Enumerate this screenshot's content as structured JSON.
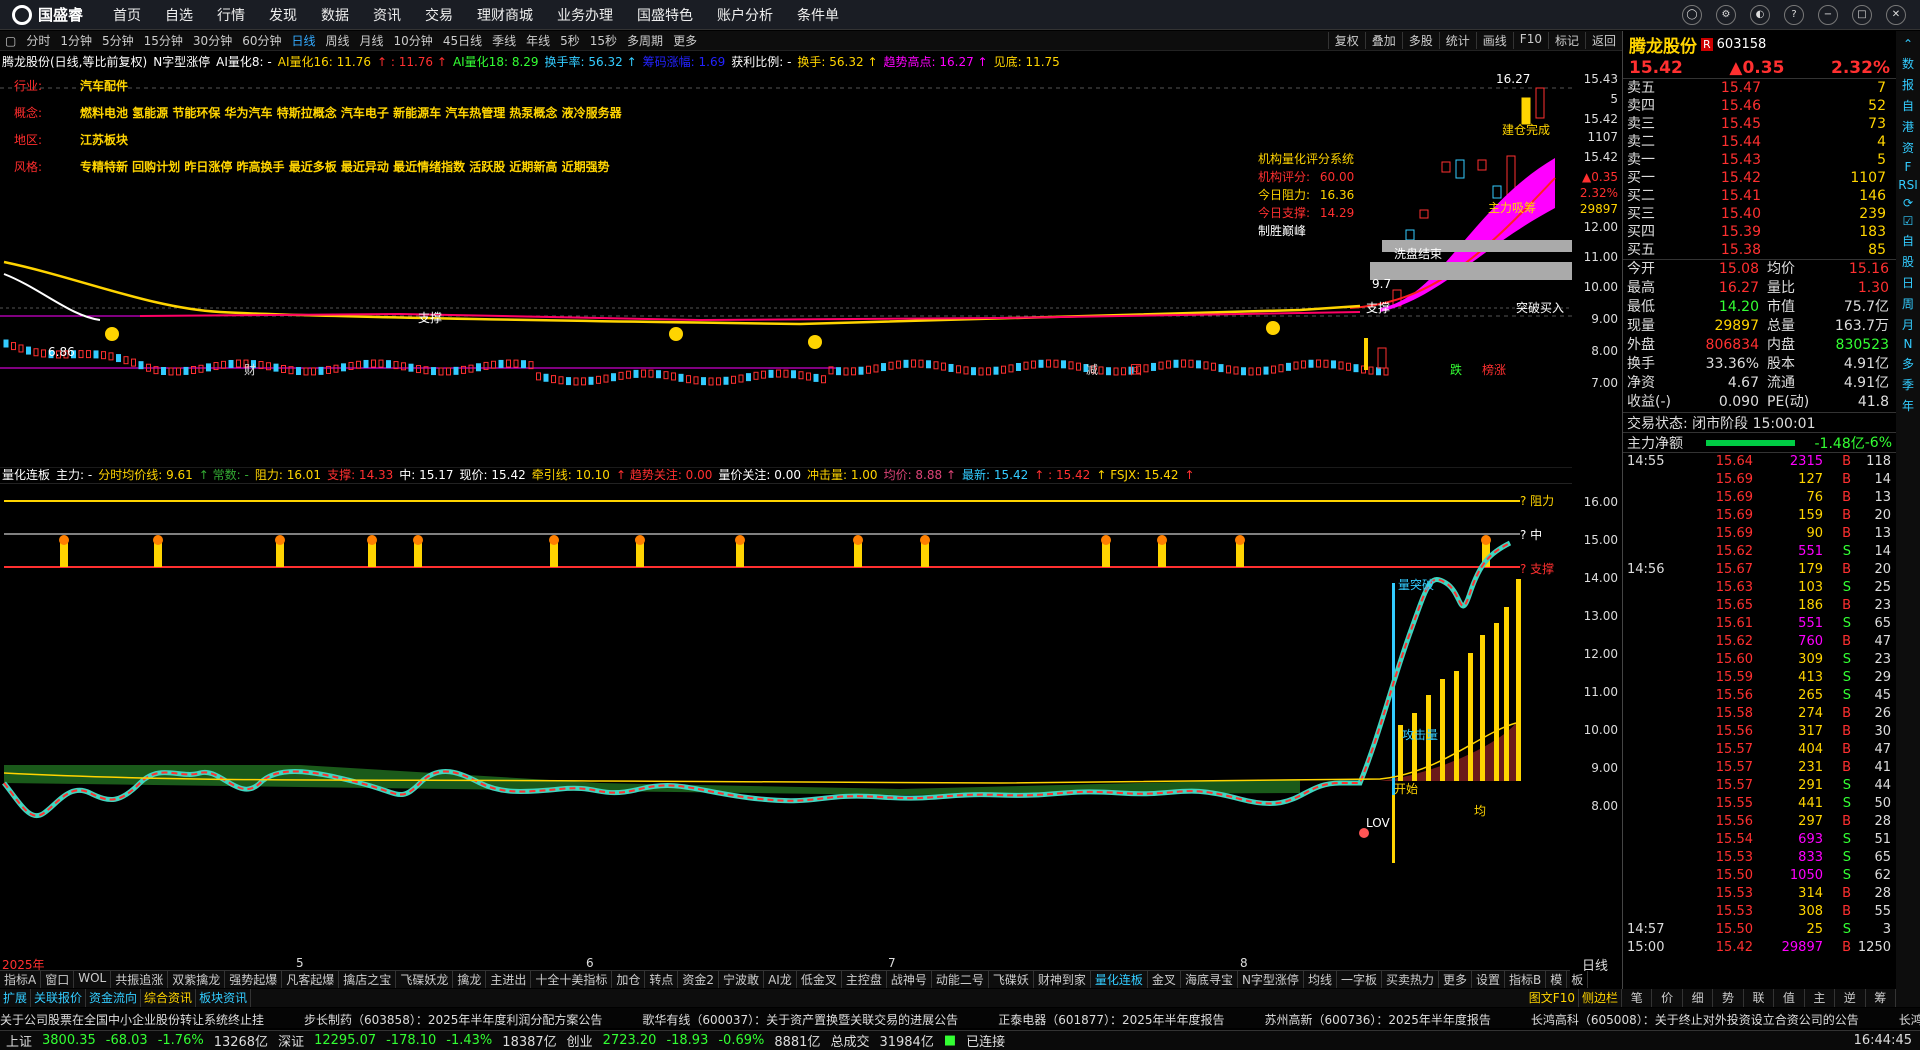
{
  "app": {
    "logo": "国盛睿",
    "menu": [
      "首页",
      "自选",
      "行情",
      "发现",
      "数据",
      "资讯",
      "交易",
      "理财商城",
      "业务办理",
      "国盛特色",
      "账户分析",
      "条件单"
    ]
  },
  "periods": [
    "分时",
    "1分钟",
    "5分钟",
    "15分钟",
    "30分钟",
    "60分钟",
    "日线",
    "周线",
    "月线",
    "10分钟",
    "45日线",
    "季线",
    "年线",
    "5秒",
    "15秒",
    "多周期",
    "更多"
  ],
  "toolbar": [
    "复权",
    "叠加",
    "多股",
    "统计",
    "画线",
    "F10",
    "标记",
    "返回"
  ],
  "legend1": [
    {
      "t": "腾龙股份(日线,等比前复权)",
      "c": "#fff"
    },
    {
      "t": "N字型涨停",
      "c": "#fff"
    },
    {
      "t": "AI量化8: -",
      "c": "#fff"
    },
    {
      "t": "AI量化16: 11.76",
      "c": "#ffd400"
    },
    {
      "t": "↑ : 11.76 ↑",
      "c": "#ff3030"
    },
    {
      "t": "AI量化18: 8.29",
      "c": "#3f3"
    },
    {
      "t": "换手率: 56.32 ↑",
      "c": "#3cf"
    },
    {
      "t": "筹码涨幅: 1.69",
      "c": "#22f"
    },
    {
      "t": "获利比例: -",
      "c": "#fff"
    },
    {
      "t": "换手: 56.32 ↑",
      "c": "#ffd400"
    },
    {
      "t": "趋势高点: 16.27 ↑",
      "c": "#f0f"
    },
    {
      "t": "见底: 11.75",
      "c": "#ffd400"
    }
  ],
  "info": [
    {
      "k": "行业:",
      "v": "汽车配件"
    },
    {
      "k": "概念:",
      "v": "燃料电池 氢能源 节能环保 华为汽车 特斯拉概念 汽车电子 新能源车 汽车热管理 热泵概念 液冷服务器"
    },
    {
      "k": "地区:",
      "v": "江苏板块"
    },
    {
      "k": "风格:",
      "v": "专精特新 回购计划 昨日涨停 昨高换手 最近多板 最近异动 最近情绪指数 活跃股 近期新高 近期强势"
    }
  ],
  "inst": {
    "title": "机构量化评分系统",
    "rows": [
      {
        "k": "机构评分:",
        "v": "60.00",
        "c": "#ff3030"
      },
      {
        "k": "今日阻力:",
        "v": "16.36",
        "c": "#ffd400"
      },
      {
        "k": "今日支撑:",
        "v": "14.29",
        "c": "#ff3030"
      }
    ],
    "foot": "制胜巅峰"
  },
  "chart1_labels": {
    "high": "16.27",
    "low": "6.86",
    "zhicheng1": "支撑",
    "zhicheng2": "支撑",
    "jiancang": "建仓完成",
    "zhuli": "主力吸筹",
    "xipan": "洗盘结束",
    "tupo": "突破买入",
    "cai": "财",
    "jian": "减",
    "hui": "回",
    "die": "跌",
    "zhang": "榜涨",
    "v97": "9.7"
  },
  "axis1": [
    "15.43",
    "5",
    "15.42",
    "1107",
    "15.42",
    "▲0.35",
    "2.32%",
    "29897",
    "12.00",
    "11.00",
    "10.00",
    "9.00",
    "8.00",
    "7.00"
  ],
  "legend2": [
    {
      "t": "量化连板",
      "c": "#fff"
    },
    {
      "t": "主力: -",
      "c": "#fff"
    },
    {
      "t": "分时均价线: 9.61",
      "c": "#ffd400"
    },
    {
      "t": "↑ 常数: -",
      "c": "#3a3"
    },
    {
      "t": "阻力: 16.01",
      "c": "#ffd400"
    },
    {
      "t": "支撑: 14.33",
      "c": "#ff3030"
    },
    {
      "t": "中: 15.17",
      "c": "#fff"
    },
    {
      "t": "现价: 15.42",
      "c": "#fff"
    },
    {
      "t": "牵引线: 10.10",
      "c": "#ffd400"
    },
    {
      "t": "↑ 趋势关注: 0.00",
      "c": "#ff3030"
    },
    {
      "t": "量价关注: 0.00",
      "c": "#fff"
    },
    {
      "t": "冲击量: 1.00",
      "c": "#ffd400"
    },
    {
      "t": "均价: 8.88 ↑",
      "c": "#d47"
    },
    {
      "t": "最新: 15.42",
      "c": "#3cf"
    },
    {
      "t": "↑ : 15.42",
      "c": "#ff3030"
    },
    {
      "t": "↑ FSJX: 15.42",
      "c": "#ffd400"
    },
    {
      "t": "↑",
      "c": "#ff3030"
    }
  ],
  "axis2": [
    "16.00",
    "15.00",
    "14.00",
    "13.00",
    "12.00",
    "11.00",
    "10.00",
    "9.00",
    "8.00"
  ],
  "chart2_labels": {
    "zuli": "? 阻力",
    "zhong": "? 中",
    "zhicheng": "? 支撑",
    "liangtu": "量突破",
    "gongji": "攻击量",
    "kaishi": "开始",
    "jun": "均",
    "lov": "LOV"
  },
  "xdates": [
    "2025年",
    "5",
    "6",
    "7",
    "8"
  ],
  "rixian": "日线",
  "bottom_tabs": [
    "指标A",
    "窗口",
    "WOL",
    "共振追涨",
    "双紫擒龙",
    "强势起爆",
    "凡客起爆",
    "擒店之宝",
    "飞碟妖龙",
    "擒龙",
    "主进出",
    "十全十美指标",
    "加仓",
    "转点",
    "资金2",
    "宁波敢",
    "AI龙",
    "低金叉",
    "主控盘",
    "战神号",
    "动能二号",
    "飞碟妖",
    "财神到家",
    "量化连板",
    "金叉",
    "海底寻宝",
    "N字型涨停",
    "均线",
    "一字板",
    "买卖热力",
    "更多",
    "设置"
  ],
  "bottom_right": [
    "指标B",
    "模",
    "板"
  ],
  "bottom2": [
    "扩展",
    "关联报价",
    "资金流向",
    "综合资讯",
    "板块资讯"
  ],
  "bottom2_right": [
    "图文F10",
    "侧边栏"
  ],
  "ticker": [
    "关于公司股票在全国中小企业股份转让系统终止挂",
    "步长制药（603858）：2025年半年度利润分配方案公告",
    "歌华有线（600037）：关于资产置换暨关联交易的进展公告",
    "正泰电器（601877）：2025年半年度报告",
    "苏州高新（600736）：2025年半年度报告",
    "长鸿高科（605008）：关于终止对外投资设立合资公司的公告",
    "长鸿高"
  ],
  "status": {
    "sh": "上证",
    "sh_v": "3800.35",
    "sh_c": "-68.03",
    "sh_p": "-1.76%",
    "sh_a": "13268亿",
    "sz": "深证",
    "sz_v": "12295.07",
    "sz_c": "-178.10",
    "sz_p": "-1.43%",
    "sz_a": "18387亿",
    "cy": "创业",
    "cy_v": "2723.20",
    "cy_c": "-18.93",
    "cy_p": "-0.69%",
    "cy_a": "8881亿",
    "tot": "总成交",
    "tot_v": "31984亿",
    "conn": "已连接",
    "time": "16:44:45"
  },
  "rp": {
    "name": "腾龙股份",
    "code": "603158",
    "tag": "R",
    "price": "15.42",
    "chg": "▲0.35",
    "pct": "2.32%",
    "asks": [
      {
        "l": "卖五",
        "p": "15.47",
        "q": "7"
      },
      {
        "l": "卖四",
        "p": "15.46",
        "q": "52"
      },
      {
        "l": "卖三",
        "p": "15.45",
        "q": "73"
      },
      {
        "l": "卖二",
        "p": "15.44",
        "q": "4"
      },
      {
        "l": "卖一",
        "p": "15.43",
        "q": "5"
      }
    ],
    "bids": [
      {
        "l": "买一",
        "p": "15.42",
        "q": "1107"
      },
      {
        "l": "买二",
        "p": "15.41",
        "q": "146"
      },
      {
        "l": "买三",
        "p": "15.40",
        "q": "239"
      },
      {
        "l": "买四",
        "p": "15.39",
        "q": "183"
      },
      {
        "l": "买五",
        "p": "15.38",
        "q": "85"
      }
    ],
    "stats": [
      {
        "l": "今开",
        "v": "15.08",
        "vc": "#ff3030",
        "l2": "均价",
        "v2": "15.16",
        "v2c": "#ff3030"
      },
      {
        "l": "最高",
        "v": "16.27",
        "vc": "#ff3030",
        "l2": "量比",
        "v2": "1.30",
        "v2c": "#ff3030"
      },
      {
        "l": "最低",
        "v": "14.20",
        "vc": "#3f3",
        "l2": "市值",
        "v2": "75.7亿",
        "v2c": "#ddd"
      },
      {
        "l": "现量",
        "v": "29897",
        "vc": "#ffd400",
        "l2": "总量",
        "v2": "163.7万",
        "v2c": "#ddd"
      },
      {
        "l": "外盘",
        "v": "806834",
        "vc": "#ff3030",
        "l2": "内盘",
        "v2": "830523",
        "v2c": "#3f3"
      },
      {
        "l": "换手",
        "v": "33.36%",
        "vc": "#ddd",
        "l2": "股本",
        "v2": "4.91亿",
        "v2c": "#ddd"
      },
      {
        "l": "净资",
        "v": "4.67",
        "vc": "#ddd",
        "l2": "流通",
        "v2": "4.91亿",
        "v2c": "#ddd"
      },
      {
        "l": "收益(-)",
        "v": "0.090",
        "vc": "#ddd",
        "l2": "PE(动)",
        "v2": "41.8",
        "v2c": "#ddd"
      }
    ],
    "phase": "交易状态: 闭市阶段 15:00:01",
    "net_l": "主力净额",
    "net_v": "-1.48亿",
    "net_p": "-6%",
    "trades": [
      {
        "t": "14:55",
        "p": "15.64",
        "v": "2315",
        "bs": "B",
        "n": "118",
        "vc": "#f0f"
      },
      {
        "t": "",
        "p": "15.69",
        "v": "127",
        "bs": "B",
        "n": "14",
        "vc": "#ffd400"
      },
      {
        "t": "",
        "p": "15.69",
        "v": "76",
        "bs": "B",
        "n": "13",
        "vc": "#ffd400"
      },
      {
        "t": "",
        "p": "15.69",
        "v": "159",
        "bs": "B",
        "n": "20",
        "vc": "#ffd400"
      },
      {
        "t": "",
        "p": "15.69",
        "v": "90",
        "bs": "B",
        "n": "13",
        "vc": "#ffd400"
      },
      {
        "t": "",
        "p": "15.62",
        "v": "551",
        "bs": "S",
        "n": "14",
        "vc": "#f0f"
      },
      {
        "t": "14:56",
        "p": "15.67",
        "v": "179",
        "bs": "B",
        "n": "20",
        "vc": "#ffd400"
      },
      {
        "t": "",
        "p": "15.63",
        "v": "103",
        "bs": "S",
        "n": "25",
        "vc": "#ffd400"
      },
      {
        "t": "",
        "p": "15.65",
        "v": "186",
        "bs": "B",
        "n": "23",
        "vc": "#ffd400"
      },
      {
        "t": "",
        "p": "15.61",
        "v": "551",
        "bs": "S",
        "n": "65",
        "vc": "#f0f"
      },
      {
        "t": "",
        "p": "15.62",
        "v": "760",
        "bs": "B",
        "n": "47",
        "vc": "#f0f"
      },
      {
        "t": "",
        "p": "15.60",
        "v": "309",
        "bs": "S",
        "n": "23",
        "vc": "#ffd400"
      },
      {
        "t": "",
        "p": "15.59",
        "v": "413",
        "bs": "S",
        "n": "29",
        "vc": "#ffd400"
      },
      {
        "t": "",
        "p": "15.56",
        "v": "265",
        "bs": "S",
        "n": "45",
        "vc": "#ffd400"
      },
      {
        "t": "",
        "p": "15.58",
        "v": "274",
        "bs": "B",
        "n": "26",
        "vc": "#ffd400"
      },
      {
        "t": "",
        "p": "15.56",
        "v": "317",
        "bs": "B",
        "n": "30",
        "vc": "#ffd400"
      },
      {
        "t": "",
        "p": "15.57",
        "v": "404",
        "bs": "B",
        "n": "47",
        "vc": "#ffd400"
      },
      {
        "t": "",
        "p": "15.57",
        "v": "231",
        "bs": "B",
        "n": "41",
        "vc": "#ffd400"
      },
      {
        "t": "",
        "p": "15.57",
        "v": "291",
        "bs": "S",
        "n": "44",
        "vc": "#ffd400"
      },
      {
        "t": "",
        "p": "15.55",
        "v": "441",
        "bs": "S",
        "n": "50",
        "vc": "#ffd400"
      },
      {
        "t": "",
        "p": "15.56",
        "v": "297",
        "bs": "B",
        "n": "28",
        "vc": "#ffd400"
      },
      {
        "t": "",
        "p": "15.54",
        "v": "693",
        "bs": "S",
        "n": "51",
        "vc": "#f0f"
      },
      {
        "t": "",
        "p": "15.53",
        "v": "833",
        "bs": "S",
        "n": "65",
        "vc": "#f0f"
      },
      {
        "t": "",
        "p": "15.50",
        "v": "1050",
        "bs": "S",
        "n": "62",
        "vc": "#f0f"
      },
      {
        "t": "",
        "p": "15.53",
        "v": "314",
        "bs": "B",
        "n": "28",
        "vc": "#ffd400"
      },
      {
        "t": "",
        "p": "15.53",
        "v": "308",
        "bs": "B",
        "n": "55",
        "vc": "#ffd400"
      },
      {
        "t": "14:57",
        "p": "15.50",
        "v": "25",
        "bs": "S",
        "n": "3",
        "vc": "#ffd400"
      },
      {
        "t": "15:00",
        "p": "15.42",
        "v": "29897",
        "bs": "B",
        "n": "1250",
        "vc": "#f0f"
      }
    ],
    "tabs": [
      "笔",
      "价",
      "细",
      "势",
      "联",
      "值",
      "主",
      "逆",
      "筹"
    ]
  },
  "sidebar": [
    "⌃",
    "数",
    "报",
    "自",
    "港",
    "资",
    "F",
    "RSI",
    "⟳",
    "☑",
    "自",
    "股",
    "日",
    "周",
    "月",
    "N",
    "多",
    "季",
    "年"
  ]
}
